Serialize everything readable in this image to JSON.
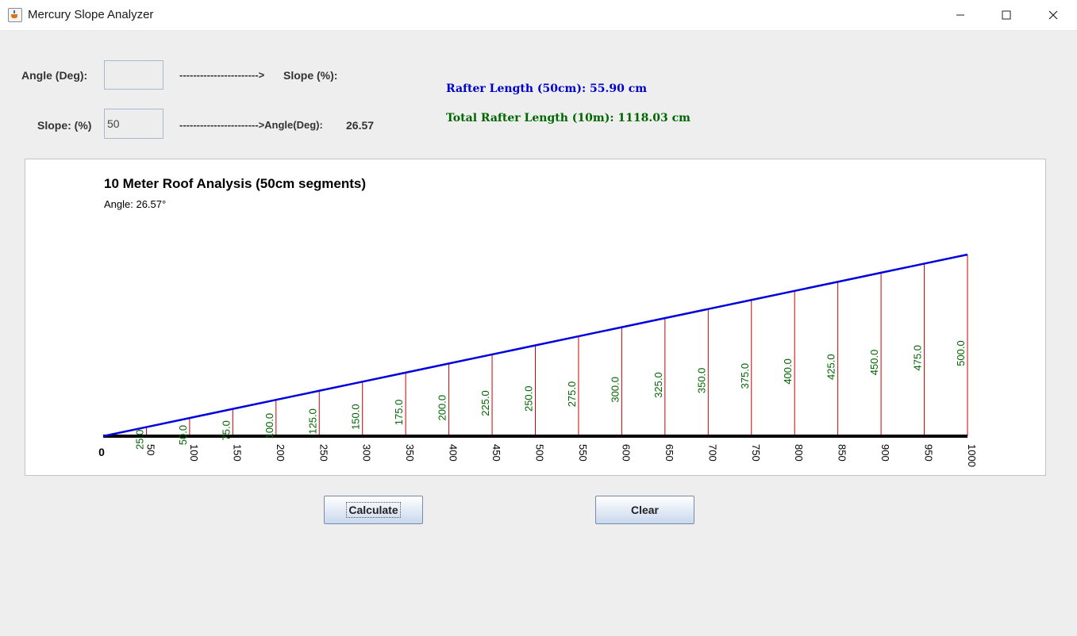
{
  "window": {
    "title": "Mercury Slope Analyzer"
  },
  "form": {
    "angle_label": "Angle (Deg):",
    "angle_value": "",
    "arrow1": "----------------------->",
    "slope_out_label": "Slope (%):",
    "slope_label": "Slope: (%)",
    "slope_value": "50",
    "arrow2": "----------------------->Angle(Deg):",
    "angle_out_value": "26.57"
  },
  "results": {
    "rafter_length": "Rafter Length (50cm): 55.90 cm",
    "total_rafter_length": "Total Rafter Length (10m): 1118.03 cm",
    "rafter_color": "#0000cc",
    "total_color": "#006600"
  },
  "chart_data": {
    "type": "line",
    "title": "10 Meter Roof Analysis (50cm segments)",
    "subtitle": "Angle: 26.57°",
    "x_ticks": [
      "0",
      "50",
      "100",
      "150",
      "200",
      "250",
      "300",
      "350",
      "400",
      "450",
      "500",
      "550",
      "600",
      "650",
      "700",
      "750",
      "800",
      "850",
      "900",
      "950",
      "1000"
    ],
    "x": [
      0,
      50,
      100,
      150,
      200,
      250,
      300,
      350,
      400,
      450,
      500,
      550,
      600,
      650,
      700,
      750,
      800,
      850,
      900,
      950,
      1000
    ],
    "y": [
      0,
      25,
      50,
      75,
      100,
      125,
      150,
      175,
      200,
      225,
      250,
      275,
      300,
      325,
      350,
      375,
      400,
      425,
      450,
      475,
      500
    ],
    "height_labels": [
      "25.0",
      "50.0",
      "75.0",
      "100.0",
      "125.0",
      "150.0",
      "175.0",
      "200.0",
      "225.0",
      "250.0",
      "275.0",
      "300.0",
      "325.0",
      "350.0",
      "375.0",
      "400.0",
      "425.0",
      "450.0",
      "475.0",
      "500.0"
    ],
    "xlim": [
      0,
      1000
    ],
    "ylim": [
      0,
      500
    ],
    "roof_color": "#0000dd",
    "post_color": "#cc0000",
    "label_color": "#006600",
    "base_color": "#000000"
  },
  "buttons": {
    "calculate": "Calculate",
    "clear": "Clear"
  }
}
